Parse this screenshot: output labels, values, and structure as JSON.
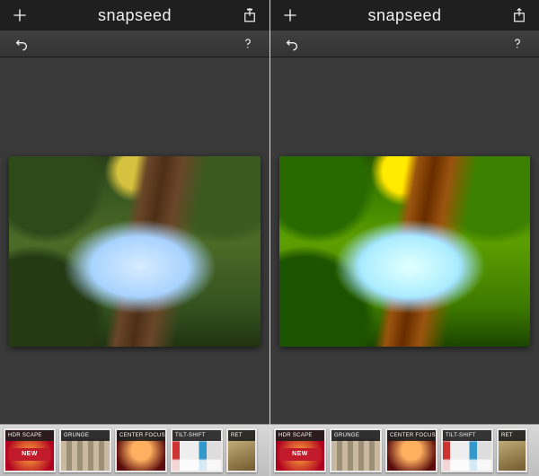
{
  "app": {
    "title": "snapseed"
  },
  "colors": {
    "badge_bg": "#c11a2b"
  },
  "filters": [
    {
      "key": "hdr",
      "label": "HDR SCAPE",
      "thumb": "thumb-hdr",
      "badge": "NEW"
    },
    {
      "key": "grunge",
      "label": "GRUNGE",
      "thumb": "thumb-grunge",
      "badge": null
    },
    {
      "key": "center",
      "label": "CENTER FOCUS",
      "thumb": "thumb-center",
      "badge": null
    },
    {
      "key": "tilt",
      "label": "TILT-SHIFT",
      "thumb": "thumb-tilt",
      "badge": null
    },
    {
      "key": "retro",
      "label": "RET",
      "thumb": "thumb-retro",
      "badge": null,
      "partial": true
    }
  ],
  "panes": [
    {
      "photo_variant": "left"
    },
    {
      "photo_variant": "right"
    }
  ]
}
